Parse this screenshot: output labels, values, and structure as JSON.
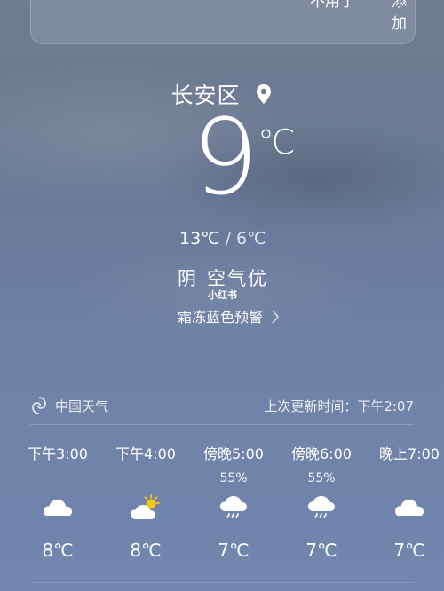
{
  "header": {
    "decline_label": "不用了",
    "add_label": "添加"
  },
  "location": {
    "name": "长安区"
  },
  "current": {
    "temp": "9",
    "unit": "℃",
    "high": "13℃",
    "separator": "/",
    "low": "6℃",
    "condition": "阴",
    "air_quality": "空气优",
    "alert": "霜冻蓝色预警"
  },
  "watermark": "小红书",
  "source": {
    "provider": "中国天气",
    "updated_label": "上次更新时间：下午2:07"
  },
  "hourly": [
    {
      "time": "下午3:00",
      "pop": "",
      "icon": "cloud-icon",
      "temp": "8℃"
    },
    {
      "time": "下午4:00",
      "pop": "",
      "icon": "partly-sunny-icon",
      "temp": "8℃"
    },
    {
      "time": "傍晚5:00",
      "pop": "55%",
      "icon": "rain-icon",
      "temp": "7℃"
    },
    {
      "time": "傍晚6:00",
      "pop": "55%",
      "icon": "rain-icon",
      "temp": "7℃"
    },
    {
      "time": "晚上7:00",
      "pop": "",
      "icon": "cloud-icon",
      "temp": "7℃"
    }
  ],
  "colors": {
    "sun": "#f5c518",
    "cloud": "#ffffff",
    "rain": "#ffffff"
  }
}
